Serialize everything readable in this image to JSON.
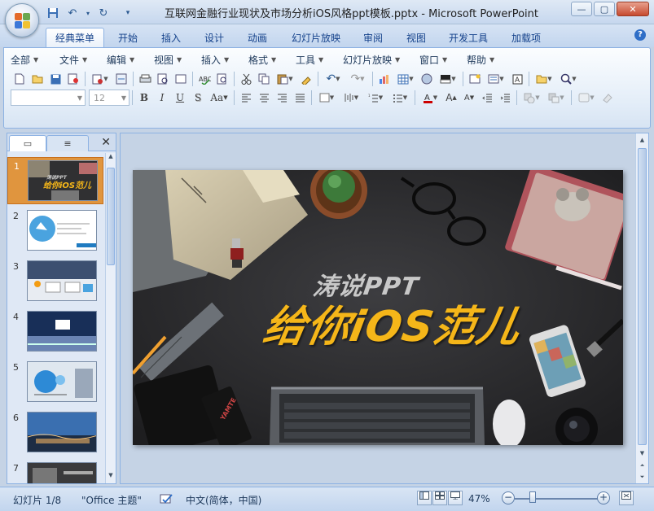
{
  "window": {
    "title": "互联网金融行业现状及市场分析iOS风格ppt模板.pptx - Microsoft PowerPoint",
    "controls": {
      "minimize": "—",
      "maximize": "▢",
      "close": "✕"
    }
  },
  "quick_access": {
    "save": "💾",
    "undo": "↶",
    "redo": "↻",
    "customize": "▾"
  },
  "ribbon_tabs": [
    {
      "label": "经典菜单",
      "active": true
    },
    {
      "label": "开始"
    },
    {
      "label": "插入"
    },
    {
      "label": "设计"
    },
    {
      "label": "动画"
    },
    {
      "label": "幻灯片放映"
    },
    {
      "label": "审阅"
    },
    {
      "label": "视图"
    },
    {
      "label": "开发工具"
    },
    {
      "label": "加载项"
    }
  ],
  "help_icon": "?",
  "classic_menu": [
    "全部",
    "文件",
    "编辑",
    "视图",
    "插入",
    "格式",
    "工具",
    "幻灯片放映",
    "窗口",
    "帮助"
  ],
  "font_box": {
    "name": "",
    "size": "12"
  },
  "format_buttons": {
    "bold": "B",
    "italic": "I",
    "underline": "U",
    "shadow": "S",
    "case": "Aa"
  },
  "left_pane": {
    "tabs": [
      {
        "label": "▭"
      },
      {
        "label": "≡"
      }
    ],
    "close": "✕",
    "slides": [
      "1",
      "2",
      "3",
      "4",
      "5",
      "6",
      "7"
    ],
    "selected": "1"
  },
  "slide": {
    "title_top": "涛说PPT",
    "title_main": "给你iOS范儿",
    "colors": {
      "background": "#2f2f31",
      "accent": "#f5b619",
      "title_top": "#c8c8c8"
    }
  },
  "status": {
    "slide_info": "幻灯片 1/8",
    "theme": "\"Office 主题\"",
    "language": "中文(简体，中国)",
    "zoom": "47%",
    "zoom_fraction": 0.47
  }
}
